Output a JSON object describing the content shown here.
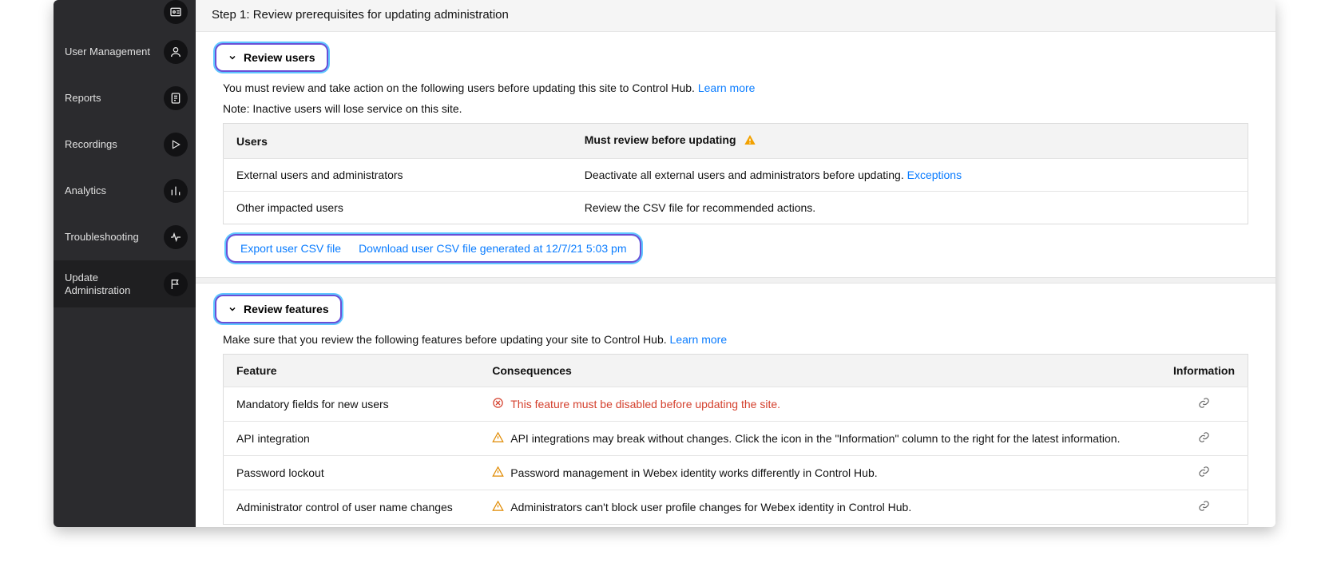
{
  "sidebar": {
    "items": [
      {
        "label": "",
        "icon": "user-card-icon"
      },
      {
        "label": "User Management",
        "icon": "user-icon"
      },
      {
        "label": "Reports",
        "icon": "document-icon"
      },
      {
        "label": "Recordings",
        "icon": "play-icon"
      },
      {
        "label": "Analytics",
        "icon": "bars-icon"
      },
      {
        "label": "Troubleshooting",
        "icon": "pulse-icon"
      },
      {
        "label": "Update Administration",
        "icon": "flag-icon",
        "active": true
      }
    ]
  },
  "step_header": "Step 1: Review prerequisites for updating administration",
  "review_users": {
    "title": "Review users",
    "intro_prefix": "You must review and take action on the following users before updating this site to Control Hub. ",
    "learn_more": "Learn more",
    "note": "Note: Inactive users will lose service on this site.",
    "table": {
      "col1": "Users",
      "col2": "Must review before updating",
      "rows": [
        {
          "c1": "External users and administrators",
          "c2_prefix": "Deactivate all external users and administrators before updating. ",
          "c2_link": "Exceptions"
        },
        {
          "c1": "Other impacted users",
          "c2_prefix": "Review the CSV file for recommended actions.",
          "c2_link": ""
        }
      ]
    },
    "csv": {
      "export": "Export user CSV file",
      "download": "Download user CSV file generated at 12/7/21 5:03 pm"
    }
  },
  "review_features": {
    "title": "Review features",
    "intro_prefix": "Make sure that you review the following features before updating your site to Control Hub. ",
    "learn_more": "Learn more",
    "table": {
      "col1": "Feature",
      "col2": "Consequences",
      "col3": "Information",
      "rows": [
        {
          "feature": "Mandatory fields for new users",
          "consequence": "This feature must be disabled before updating the site.",
          "severity": "error"
        },
        {
          "feature": "API integration",
          "consequence": "API integrations may break without changes. Click the icon in the \"Information\"  column to the right for the latest information.",
          "severity": "warn"
        },
        {
          "feature": "Password lockout",
          "consequence": "Password management in Webex identity works differently in Control Hub.",
          "severity": "warn"
        },
        {
          "feature": "Administrator control of user name changes",
          "consequence": "Administrators can't block user profile changes for Webex identity in Control Hub.",
          "severity": "warn"
        }
      ]
    }
  }
}
